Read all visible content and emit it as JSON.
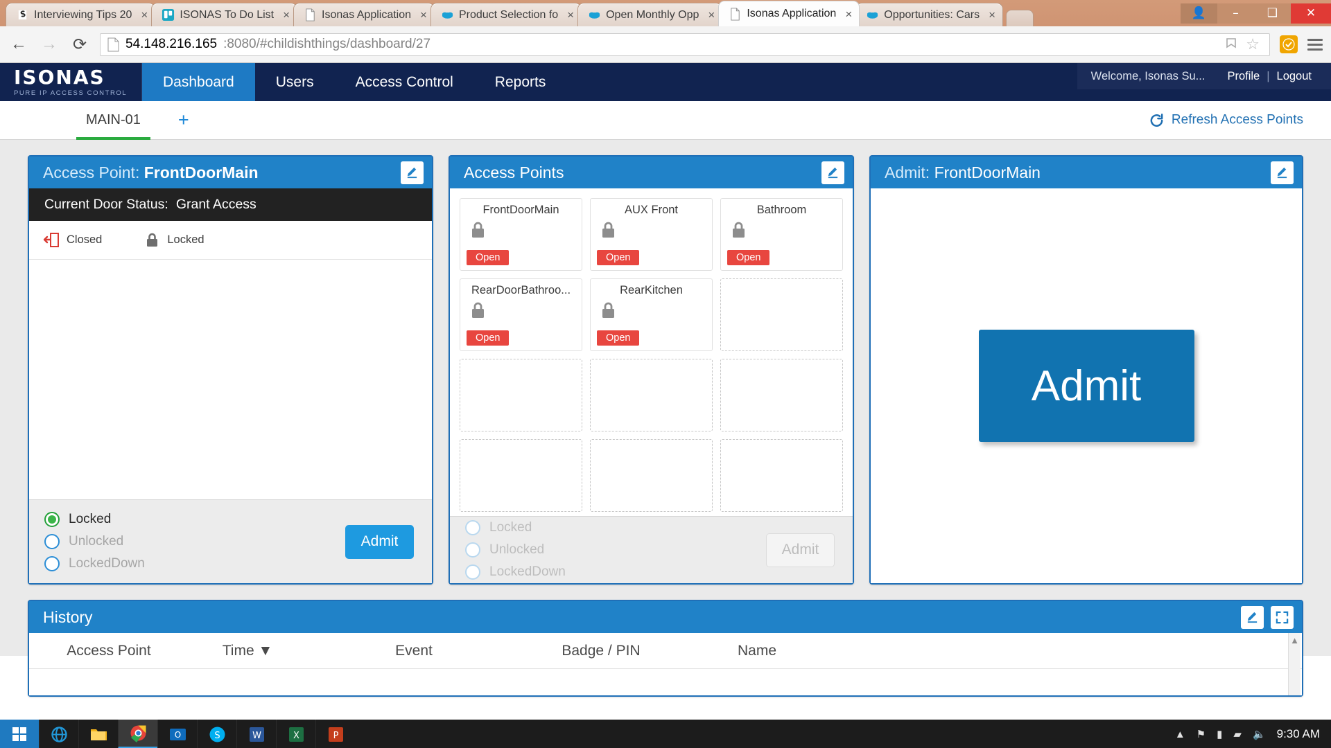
{
  "browser": {
    "tabs": [
      {
        "title": "Interviewing Tips 20",
        "icon": "skype-icon",
        "active": false
      },
      {
        "title": "ISONAS To Do List",
        "icon": "trello-icon",
        "active": false
      },
      {
        "title": "Isonas Application",
        "icon": "page-icon",
        "active": false
      },
      {
        "title": "Product Selection fo",
        "icon": "salesforce-icon",
        "active": false
      },
      {
        "title": "Open Monthly Opp",
        "icon": "salesforce-icon",
        "active": false
      },
      {
        "title": "Isonas Application",
        "icon": "page-icon",
        "active": true
      },
      {
        "title": "Opportunities: Cars",
        "icon": "salesforce-icon",
        "active": false
      }
    ],
    "new_tab_label": "+",
    "close_label": "×",
    "window_controls": {
      "user_label": "👤",
      "minimize_label": "–",
      "maximize_label": "❑",
      "close_label": "✕"
    },
    "nav": {
      "back_label": "←",
      "forward_label": "→",
      "reload_label": "⟳"
    },
    "url_host": "54.148.216.165",
    "url_rest": ":8080/#childishthings/dashboard/27",
    "bookmark_label": "☆"
  },
  "app": {
    "logo_word": "ISONAS",
    "logo_tagline": "PURE IP ACCESS CONTROL",
    "nav_items": [
      {
        "label": "Dashboard",
        "active": true
      },
      {
        "label": "Users",
        "active": false
      },
      {
        "label": "Access Control",
        "active": false
      },
      {
        "label": "Reports",
        "active": false
      }
    ],
    "userbar": {
      "welcome": "Welcome, Isonas Su...",
      "profile": "Profile",
      "separator": "|",
      "logout": "Logout"
    },
    "dashboard_tabs": [
      {
        "label": "MAIN-01",
        "selected": true
      }
    ],
    "add_tab_label": "+",
    "refresh_label": "Refresh Access Points"
  },
  "access_point_panel": {
    "title_prefix": "Access Point: ",
    "title_name": "FrontDoorMain",
    "door_status_label": "Current Door Status:",
    "door_status_value": "Grant Access",
    "indicators": [
      {
        "label": "Closed",
        "icon": "door-closed-icon"
      },
      {
        "label": "Locked",
        "icon": "padlock-locked-icon"
      }
    ],
    "modes": [
      {
        "label": "Locked",
        "state": "selected"
      },
      {
        "label": "Unlocked",
        "state": "off"
      },
      {
        "label": "LockedDown",
        "state": "off"
      }
    ],
    "admit_label": "Admit"
  },
  "access_points_panel": {
    "title": "Access Points",
    "cards": [
      {
        "name": "FrontDoorMain",
        "status": "Open",
        "filled": true
      },
      {
        "name": "AUX Front",
        "status": "Open",
        "filled": true
      },
      {
        "name": "Bathroom",
        "status": "Open",
        "filled": true
      },
      {
        "name": "RearDoorBathroo...",
        "status": "Open",
        "filled": true
      },
      {
        "name": "RearKitchen",
        "status": "Open",
        "filled": true
      },
      {
        "name": "",
        "status": "",
        "filled": false
      },
      {
        "name": "",
        "status": "",
        "filled": false
      },
      {
        "name": "",
        "status": "",
        "filled": false
      },
      {
        "name": "",
        "status": "",
        "filled": false
      },
      {
        "name": "",
        "status": "",
        "filled": false
      },
      {
        "name": "",
        "status": "",
        "filled": false
      },
      {
        "name": "",
        "status": "",
        "filled": false
      }
    ],
    "modes": [
      {
        "label": "Locked",
        "state": "disabled"
      },
      {
        "label": "Unlocked",
        "state": "disabled"
      },
      {
        "label": "LockedDown",
        "state": "disabled"
      }
    ],
    "admit_label": "Admit"
  },
  "admit_panel": {
    "title_prefix": "Admit: ",
    "title_name": "FrontDoorMain",
    "button_label": "Admit"
  },
  "history_panel": {
    "title": "History",
    "columns": [
      "Access Point",
      "Time ▼",
      "Event",
      "Badge / PIN",
      "Name"
    ],
    "rows": []
  },
  "taskbar": {
    "start_label": "⊞",
    "items": [
      {
        "name": "internet-explorer-icon"
      },
      {
        "name": "file-explorer-icon"
      },
      {
        "name": "chrome-icon"
      },
      {
        "name": "outlook-icon"
      },
      {
        "name": "skype-icon"
      },
      {
        "name": "word-icon"
      },
      {
        "name": "excel-icon"
      },
      {
        "name": "powerpoint-icon"
      }
    ],
    "tray": {
      "chevron": "▲",
      "flag": "⚑",
      "battery": "▮",
      "network": "▰",
      "volume": "🔈",
      "clock": "9:30 AM"
    }
  },
  "colors": {
    "app_header": "#112350",
    "panel_header": "#2082c8",
    "accent_blue": "#1e9ae0",
    "admit_blue": "#1173b0",
    "status_red": "#e8463f",
    "tab_underline_green": "#2aab3f"
  }
}
